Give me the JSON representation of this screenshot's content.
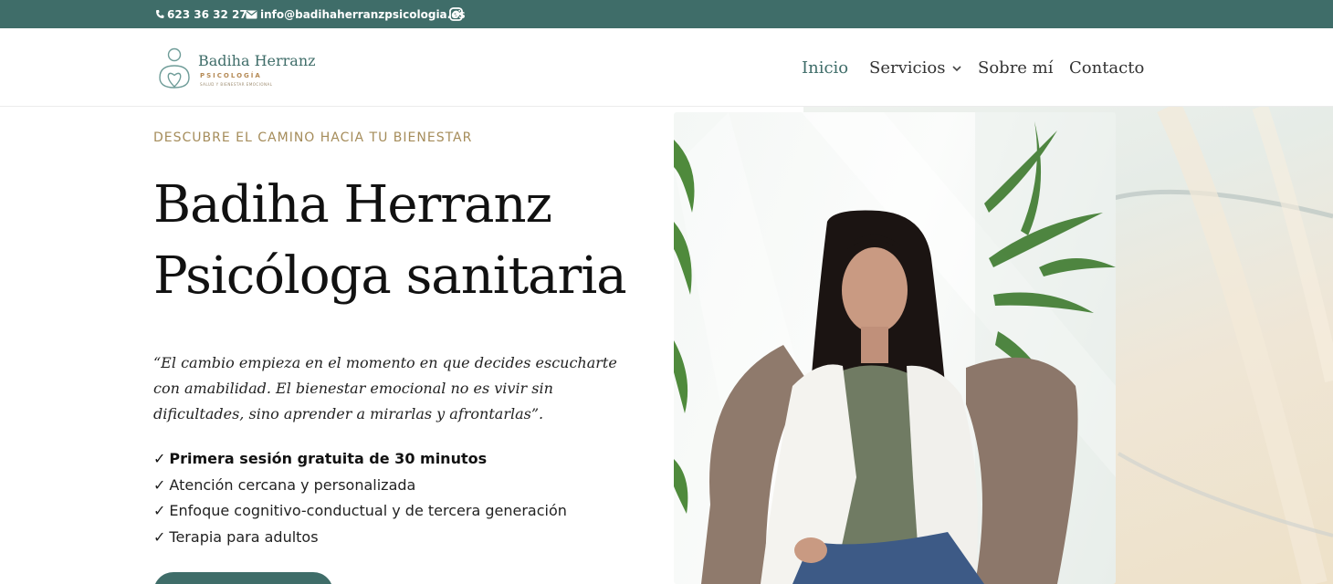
{
  "topbar": {
    "phone": "623 36 32 27",
    "email": "info@badihaherranzpsicologia.es",
    "icons": {
      "phone": "phone-icon",
      "email": "envelope-icon",
      "social": "instagram-icon"
    }
  },
  "logo": {
    "name": "Badiha Herranz",
    "subtitle": "PSICOLOGÍA",
    "tagline": "SALUD Y BIENESTAR EMOCIONAL"
  },
  "nav": {
    "items": [
      {
        "label": "Inicio",
        "active": true
      },
      {
        "label": "Servicios",
        "has_dropdown": true
      },
      {
        "label": "Sobre mí"
      },
      {
        "label": "Contacto"
      }
    ]
  },
  "hero": {
    "eyebrow": "DESCUBRE EL CAMINO HACIA TU BIENESTAR",
    "title_line1": "Badiha Herranz",
    "title_line2": "Psicóloga sanitaria",
    "quote": "“El cambio empieza en el momento en que decides escucharte con amabilidad. El bienestar emocional no es vivir sin dificultades, sino aprender a mirarlas y afrontarlas”.",
    "check_symbol": "✓",
    "benefits": [
      "Primera sesión gratuita de 30 minutos",
      "Atención cercana y personalizada",
      "Enfoque cognitivo-conductual y de tercera generación",
      "Terapia para adultos"
    ]
  },
  "colors": {
    "brand": "#3f6d69",
    "accent": "#a58c5a",
    "text": "#222222"
  }
}
